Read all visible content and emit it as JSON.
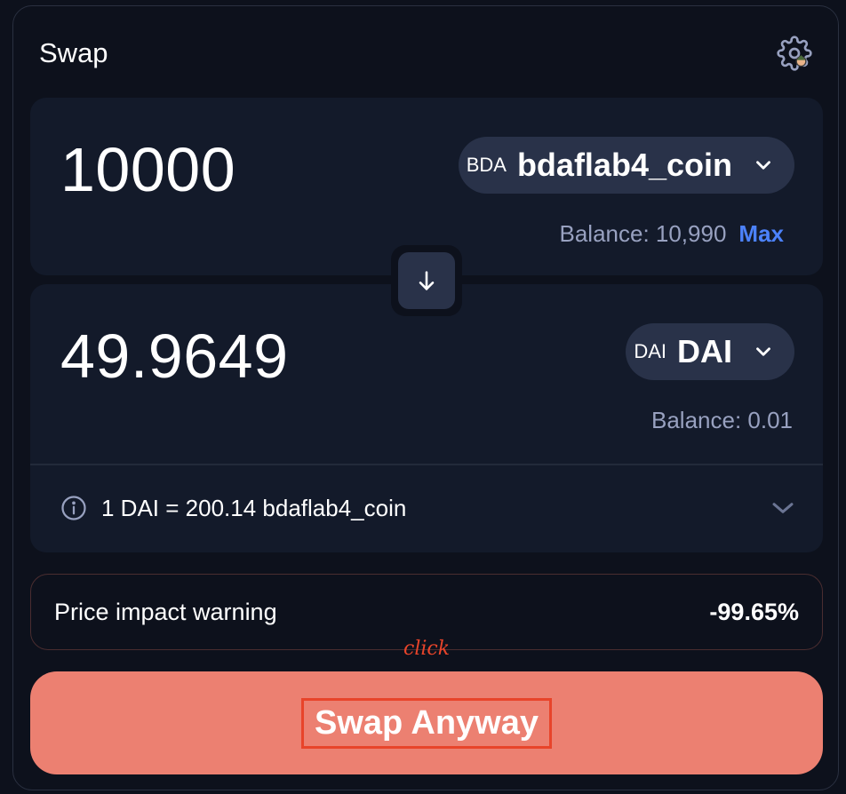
{
  "header": {
    "title": "Swap",
    "settings_icon": "gear-icon"
  },
  "input_panel": {
    "amount": "10000",
    "token_symbol": "BDA",
    "token_name": "bdaflab4_coin",
    "balance": "Balance: 10,990",
    "max_label": "Max"
  },
  "output_panel": {
    "amount": "49.9649",
    "token_symbol": "DAI",
    "token_name": "DAI",
    "balance": "Balance: 0.01"
  },
  "rate": {
    "text": "1 DAI = 200.14 bdaflab4_coin"
  },
  "warning": {
    "label": "Price impact warning",
    "value": "-99.65%"
  },
  "annotation": {
    "text": "click"
  },
  "swap_button": {
    "label": "Swap Anyway"
  },
  "colors": {
    "background": "#0d111c",
    "panel": "#131a2a",
    "token_button": "#293249",
    "accent_blue": "#4c82fb",
    "swap_button": "#ec8071",
    "annotation_red": "#e8442a"
  }
}
